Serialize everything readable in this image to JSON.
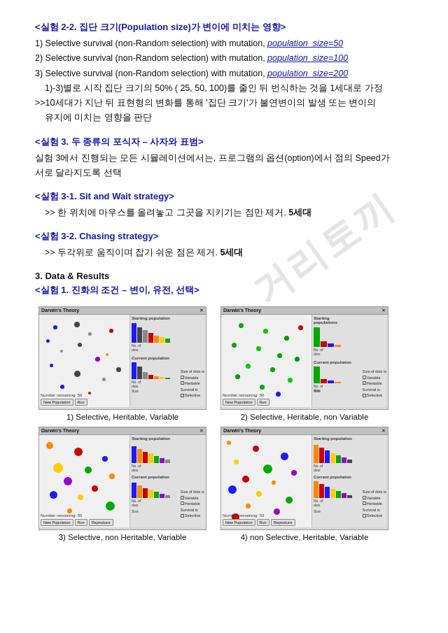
{
  "sections": [
    {
      "id": "section2-2",
      "title": "<실험 2-2. 집단 크기(Population size)가 변이에 미치는 영향>",
      "items": [
        "1) Selective survival (non-Random selection) with mutation, population_size=50",
        "2) Selective survival (non-Random selection) with mutation, population_size=100",
        "3) Selective survival (non-Random selection) with mutation, population_size=200"
      ],
      "note1": "  1)-3)별로 시작 집단 크기의 50% ( 25, 50, 100)를 줄인 뒤 번식하는 것을 1세대로 가정",
      "note2": ">>10세대가 지난 뒤 표현형의 변화를 통해 '집단 크기'가 불연변이의 발생 또는 변이의",
      "note3": "  유지에 미치는 영향을 판단"
    },
    {
      "id": "section3-title",
      "title": "<실험 3. 두 종류의 포식자 – 사자와 표범>",
      "desc": "실험 3에서 진행되는 모든 시뮬레이션에서는, 프로그램의 옵션(option)에서 점의 Speed가",
      "desc2": "서로 달라지도록 선택"
    },
    {
      "id": "section3-1",
      "title": "<실험 3-1. Sit and Wait strategy>",
      "desc": ">> 한 위치에 마우스를 올려놓고 그곳을 지키기는 점만 제거. 5세대"
    },
    {
      "id": "section3-2",
      "title": "<실험 3-2. Chasing strategy>",
      "desc": ">> 두각위로 움직이며 잡기 쉬운 점은 제거. 5세대"
    },
    {
      "id": "section-data-results",
      "title": "3. Data & Results",
      "subtitle": "<실험 1. 진화의 조건 – 변이, 유전, 선택>"
    }
  ],
  "simulations": [
    {
      "id": "sim1",
      "caption": "1) Selective, Heritable, Variable"
    },
    {
      "id": "sim2",
      "caption": "2) Selective, Heritable, non Variable"
    },
    {
      "id": "sim3",
      "caption": "3) Selective, non Heritable, Variable"
    },
    {
      "id": "sim4",
      "caption": "4) non  Selective, Heritable, Variable"
    }
  ],
  "darwin_title": "Darwin's Theory",
  "buttons": {
    "new_pop": "New Population",
    "run": "Run",
    "reproduce": "Reproduce"
  },
  "checkbox_labels": {
    "size_of_dots": "Size of dots is",
    "variable": "Variable",
    "heritable": "Heritable",
    "survival_is": "Survival is",
    "selective": "Selective"
  }
}
